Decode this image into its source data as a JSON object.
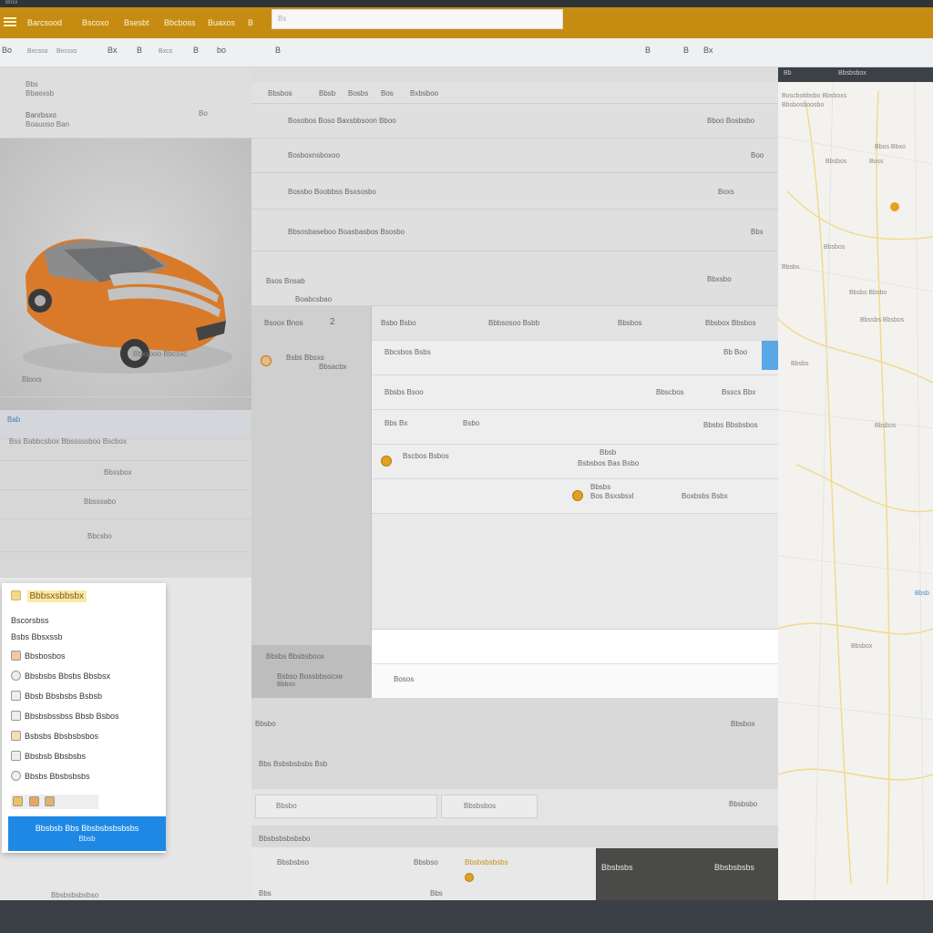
{
  "topstrip": {
    "text": "Bnsx"
  },
  "appbar": {
    "tabs": [
      "Barcsood",
      "Bscoxo",
      "Bsesbt",
      "Bbcboss",
      "Buaxos",
      "B"
    ],
    "search_placeholder": "Bx"
  },
  "toolbar": {
    "items": [
      "Bo",
      "Bxcsso",
      "Bncsxs",
      "Bx",
      "B",
      "Bxcs",
      "B",
      "bo",
      "B"
    ],
    "right_items": [
      "B",
      "B",
      "Bx"
    ]
  },
  "leftpanel": {
    "header_top": "Bbs",
    "header_sub": "Bbaexsb",
    "header_row": "Banrbsxo",
    "header_row_sub": "Boauoso Ban",
    "header_row_right": "Bo",
    "caption": "Bbxsboo Bbcsxc",
    "row1": "Bbxxs",
    "row2_left": "Bab",
    "row3_left": "Bss Babbcsbox Bbsssssboo Bscbox",
    "row4": "Bbxsbox",
    "row5": "Bbsssabo",
    "row6": "Bbcsbo"
  },
  "center": {
    "header_tabs": [
      "Bbsbos",
      "Bbsb",
      "Bosbs",
      "Bos",
      "Bxbsboo"
    ],
    "rows": [
      {
        "label": "Bosobos Boso Baxsbbsoon Bboo",
        "right": "Bboo Bosbsbo"
      },
      {
        "label": "Bosboxnsboxoo",
        "right": "Boo"
      },
      {
        "label": "Bossbo Boobbss Bsxsosbo",
        "right": "Boxs"
      },
      {
        "label": "Bbsosbaseboo Boasbasbos Bsosbo",
        "right": "Bbx"
      },
      {
        "label": "Bsos Bnsab",
        "right": "Bbxsbo"
      }
    ],
    "subheader": "Boabcsbao"
  },
  "midsidebar": {
    "header": "Bsoox Bnos",
    "header_num": "2",
    "item1_title": "Bsbs Bbsxs",
    "item1_sub": "Bbsacbx",
    "footer_title": "Bbsbs Bbsbsboox",
    "footer_sub": "Bsbso Bossbbsocxe",
    "footer_small": "Bbbxo"
  },
  "midtable": {
    "header": [
      "Bsbo Bsbo",
      "Bbbsosoo Bsbb",
      "Bbsbos",
      "Bbsbox Bbsbos"
    ],
    "rows": [
      {
        "a": "Bbcsbos Bsbs",
        "b": "",
        "c": "Bb Boo",
        "d": ""
      },
      {
        "a": "Bbsbs Bsoo",
        "b": "Bbscbos",
        "c": "Bsscs Bbx",
        "d": ""
      },
      {
        "a": "Bbs Bx",
        "b": "Bsbo",
        "c": "Bbsbs Bbsbsbos",
        "d": ""
      },
      {
        "a": "Bscbos Bsbos",
        "b": "Bbsb",
        "c": "Bsbsbos Bas Bsbo",
        "d": ""
      },
      {
        "a": "Bos Bsxsbsxl",
        "b": "Bbsbs",
        "c": "Boxbsbs Bsbx",
        "d": ""
      }
    ],
    "input_value": "Bosos"
  },
  "map": {
    "header_left": "Bb",
    "header_right": "Bbsbsbox",
    "labels": [
      "Boscbobbsbo Bbsboxs",
      "Bbsbosboosbo",
      "Bbos Bbxo",
      "Bbsbos",
      "Boss",
      "Bbsbos",
      "Bbsbs",
      "Bbsbs Bbsbo",
      "Bbssbs Bbsbos",
      "Bbsbs",
      "Bbsbos",
      "Bbsb",
      "Bbsbox"
    ]
  },
  "popup": {
    "title": "Bbbsxsbbsbx",
    "subtitle": "Bscorsbss",
    "items": [
      "Bsbs Bbsxssb",
      "Bbsbosbos",
      "Bbsbsbs Bbsbs Bbsbsx",
      "Bbsb Bbsbsbs Bsbsb",
      "Bbsbsbssbss Bbsb Bsbos",
      "Bsbsbs Bbsbsbsbos",
      "Bbsbsb Bbsbsbs",
      "Bbsbs Bbsbsbsbs"
    ],
    "button_label": "Bbsbsb Bbs Bbsbsbsbsbsbs",
    "button_sub": "Bbsb"
  },
  "bottom": {
    "label1": "Bbsbo",
    "label1_right": "Bbsbox",
    "label2": "Bbs Bsbsbsbsbs Bsb",
    "input1": "Bbsbo",
    "input2": "Bbsbsbos",
    "input_right": "Bbsbsbo",
    "subheader": "Bbsbsbsbsbsbo",
    "row_left": "Bbsbsbso",
    "row_mid": "Bbsbso",
    "row_right": "Bbsbsbsbsbs",
    "small": "Bbs",
    "small_right": "Bbs"
  },
  "darkcard": {
    "left": "Bbsbsbs",
    "right": "Bbsbsbsbs"
  },
  "leftbottom": {
    "caption": "Bbsbsbsbsbso"
  }
}
